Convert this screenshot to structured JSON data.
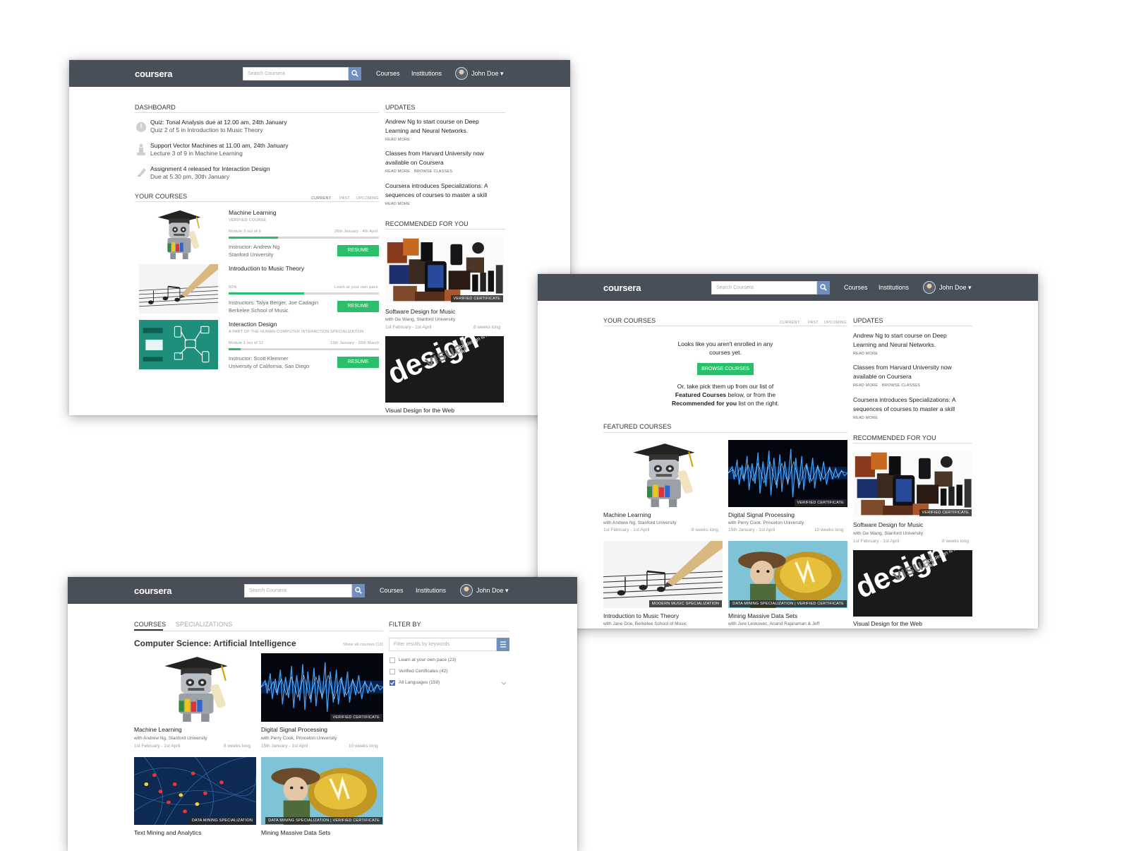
{
  "brand": "coursera",
  "nav": {
    "search_placeholder": "Search Coursera",
    "courses": "Courses",
    "institutions": "Institutions",
    "user": "John Doe ▾"
  },
  "colors": {
    "header": "#494f59",
    "accent_green": "#2bbf6c",
    "accent_blue": "#6f8fbe"
  },
  "screen1": {
    "dashboard_title": "DASHBOARD",
    "dashboard_items": [
      {
        "icon": "alert-icon",
        "title": "Quiz: Tonal Analysis due at 12.00 am, 24th January",
        "sub": "Quiz 2 of 5 in Introduction to Music Theory"
      },
      {
        "icon": "lecture-icon",
        "title": "Support Vector Machines at 11.00 am, 24th January",
        "sub": "Lecture 3 of 9 in Machine Learning"
      },
      {
        "icon": "pencil-icon",
        "title": "Assignment 4 released for Interaction Design",
        "sub": "Due at 5.30 pm, 30th January"
      }
    ],
    "your_courses_title": "YOUR COURSES",
    "course_tabs": [
      "CURRENT",
      "PAST",
      "UPCOMING"
    ],
    "courses": [
      {
        "name": "Machine Learning",
        "tag": "VERIFIED COURSE",
        "progress_label": "Module 3 out of 9",
        "dates": "26th January - 4th April",
        "progress": 0.33,
        "instructor": "Instructor: Andrew Ng",
        "school": "Stanford University",
        "button": "RESUME"
      },
      {
        "name": "Introduction to Music Theory",
        "tag": "",
        "progress_label": "50%",
        "dates": "Learn at your own pace",
        "progress": 0.5,
        "instructor": "Instructors: Talya Berger, Joe Cadagin",
        "school": "Berkelee School of Music",
        "button": "RESUME"
      },
      {
        "name": "Interaction Design",
        "tag": "A PART OF THE HUMAN-COMPUTER INTERACTION SPECIALIZATION",
        "progress_label": "Module 1 out of 12",
        "dates": "13th January - 28th March",
        "progress": 0.08,
        "instructor": "Instructor: Scott Klemmer",
        "school": "University of California, San Diego",
        "button": "RESUME"
      }
    ],
    "updates_title": "UPDATES",
    "updates": [
      {
        "text1": "Andrew Ng to start course on Deep",
        "text2": "Learning and Neural Networks.",
        "links": [
          "READ MORE"
        ]
      },
      {
        "text1": "Classes from Harvard University now",
        "text2": "available on Coursera",
        "links": [
          "READ MORE",
          "BROWSE CLASSES"
        ]
      },
      {
        "text1": "Coursera introduces Specializations: A",
        "text2": "sequences of courses to master a skill",
        "links": [
          "READ MORE"
        ]
      }
    ],
    "recommended_title": "RECOMMENDED FOR YOU",
    "recommended": [
      {
        "name": "Software Design for Music",
        "by": "with Ge Wang, Stanford University",
        "dates": "1st February - 1st April",
        "length": "8 weeks long",
        "badge": "VERIFIED CERTIFICATE"
      },
      {
        "name": "Visual Design for the Web"
      }
    ],
    "design_art": {
      "word1": "design",
      "word2": "visual",
      "tagline": "good design is made visual"
    }
  },
  "screen2": {
    "your_courses_title": "YOUR COURSES",
    "course_tabs": [
      "CURRENT",
      "PAST",
      "UPCOMING"
    ],
    "empty_line1": "Looks like you aren't enrolled in any",
    "empty_line2": "courses yet.",
    "browse_button": "BROWSE COURSES",
    "hint_line1": "Or, take pick them up from our list of",
    "hint_bold1": "Featured Courses",
    "hint_line2_rest": " below, or from the",
    "hint_bold2": "Recommended for you",
    "hint_line3_rest": " list on the right.",
    "featured_title": "FEATURED COURSES",
    "featured": [
      {
        "name": "Machine Learning",
        "by": "with Andrew Ng, Stanford University",
        "dates": "1st February - 1st April",
        "length": "8 weeks long",
        "badges": []
      },
      {
        "name": "Digital Signal Processing",
        "by": "with Perry Cook, Princeton University",
        "dates": "15th January - 1st April",
        "length": "10 weeks long",
        "badges": [
          "VERIFIED CERTIFICATE"
        ]
      },
      {
        "name": "Introduction to Music Theory",
        "by": "with Jane Doe, Berkelee School of Music",
        "badges": [
          "MODERN MUSIC SPECIALIZATION"
        ]
      },
      {
        "name": "Mining Massive Data Sets",
        "by": "with Jure Leskovec, Anand Rajaraman & Jeff",
        "badges": [
          "DATA MINING SPECIALIZATION",
          "VERIFIED CERTIFICATE"
        ]
      }
    ],
    "updates_title": "UPDATES",
    "recommended_title": "RECOMMENDED FOR YOU"
  },
  "screen3": {
    "tabs": [
      "COURSES",
      "SPECIALIZATIONS"
    ],
    "category_title": "Computer Science: Artificial Intelligence",
    "show_all": "Show all courses (13)",
    "courses": [
      {
        "name": "Machine Learning",
        "by": "with Andrew Ng, Stanford University",
        "dates": "1st February - 1st April",
        "length": "8 weeks long",
        "badges": []
      },
      {
        "name": "Digital Signal Processing",
        "by": "with Perry Cook, Princeton University",
        "dates": "15th January - 1st April",
        "length": "10 weeks long",
        "badges": [
          "VERIFIED CERTIFICATE"
        ]
      },
      {
        "name": "Text Mining and Analytics",
        "badges": [
          "DATA MINING SPECIALIZATION"
        ]
      },
      {
        "name": "Mining Massive Data Sets",
        "badges": [
          "DATA MINING SPECIALIZATION",
          "VERIFIED CERTIFICATE"
        ]
      }
    ],
    "filter_title": "FILTER BY",
    "filter_placeholder": "Filter results by keywords",
    "filters": [
      {
        "label": "Learn at your own pace (23)",
        "checked": false
      },
      {
        "label": "Verified Certificates (42)",
        "checked": false
      },
      {
        "label": "All Languages (159)",
        "checked": true
      }
    ]
  }
}
